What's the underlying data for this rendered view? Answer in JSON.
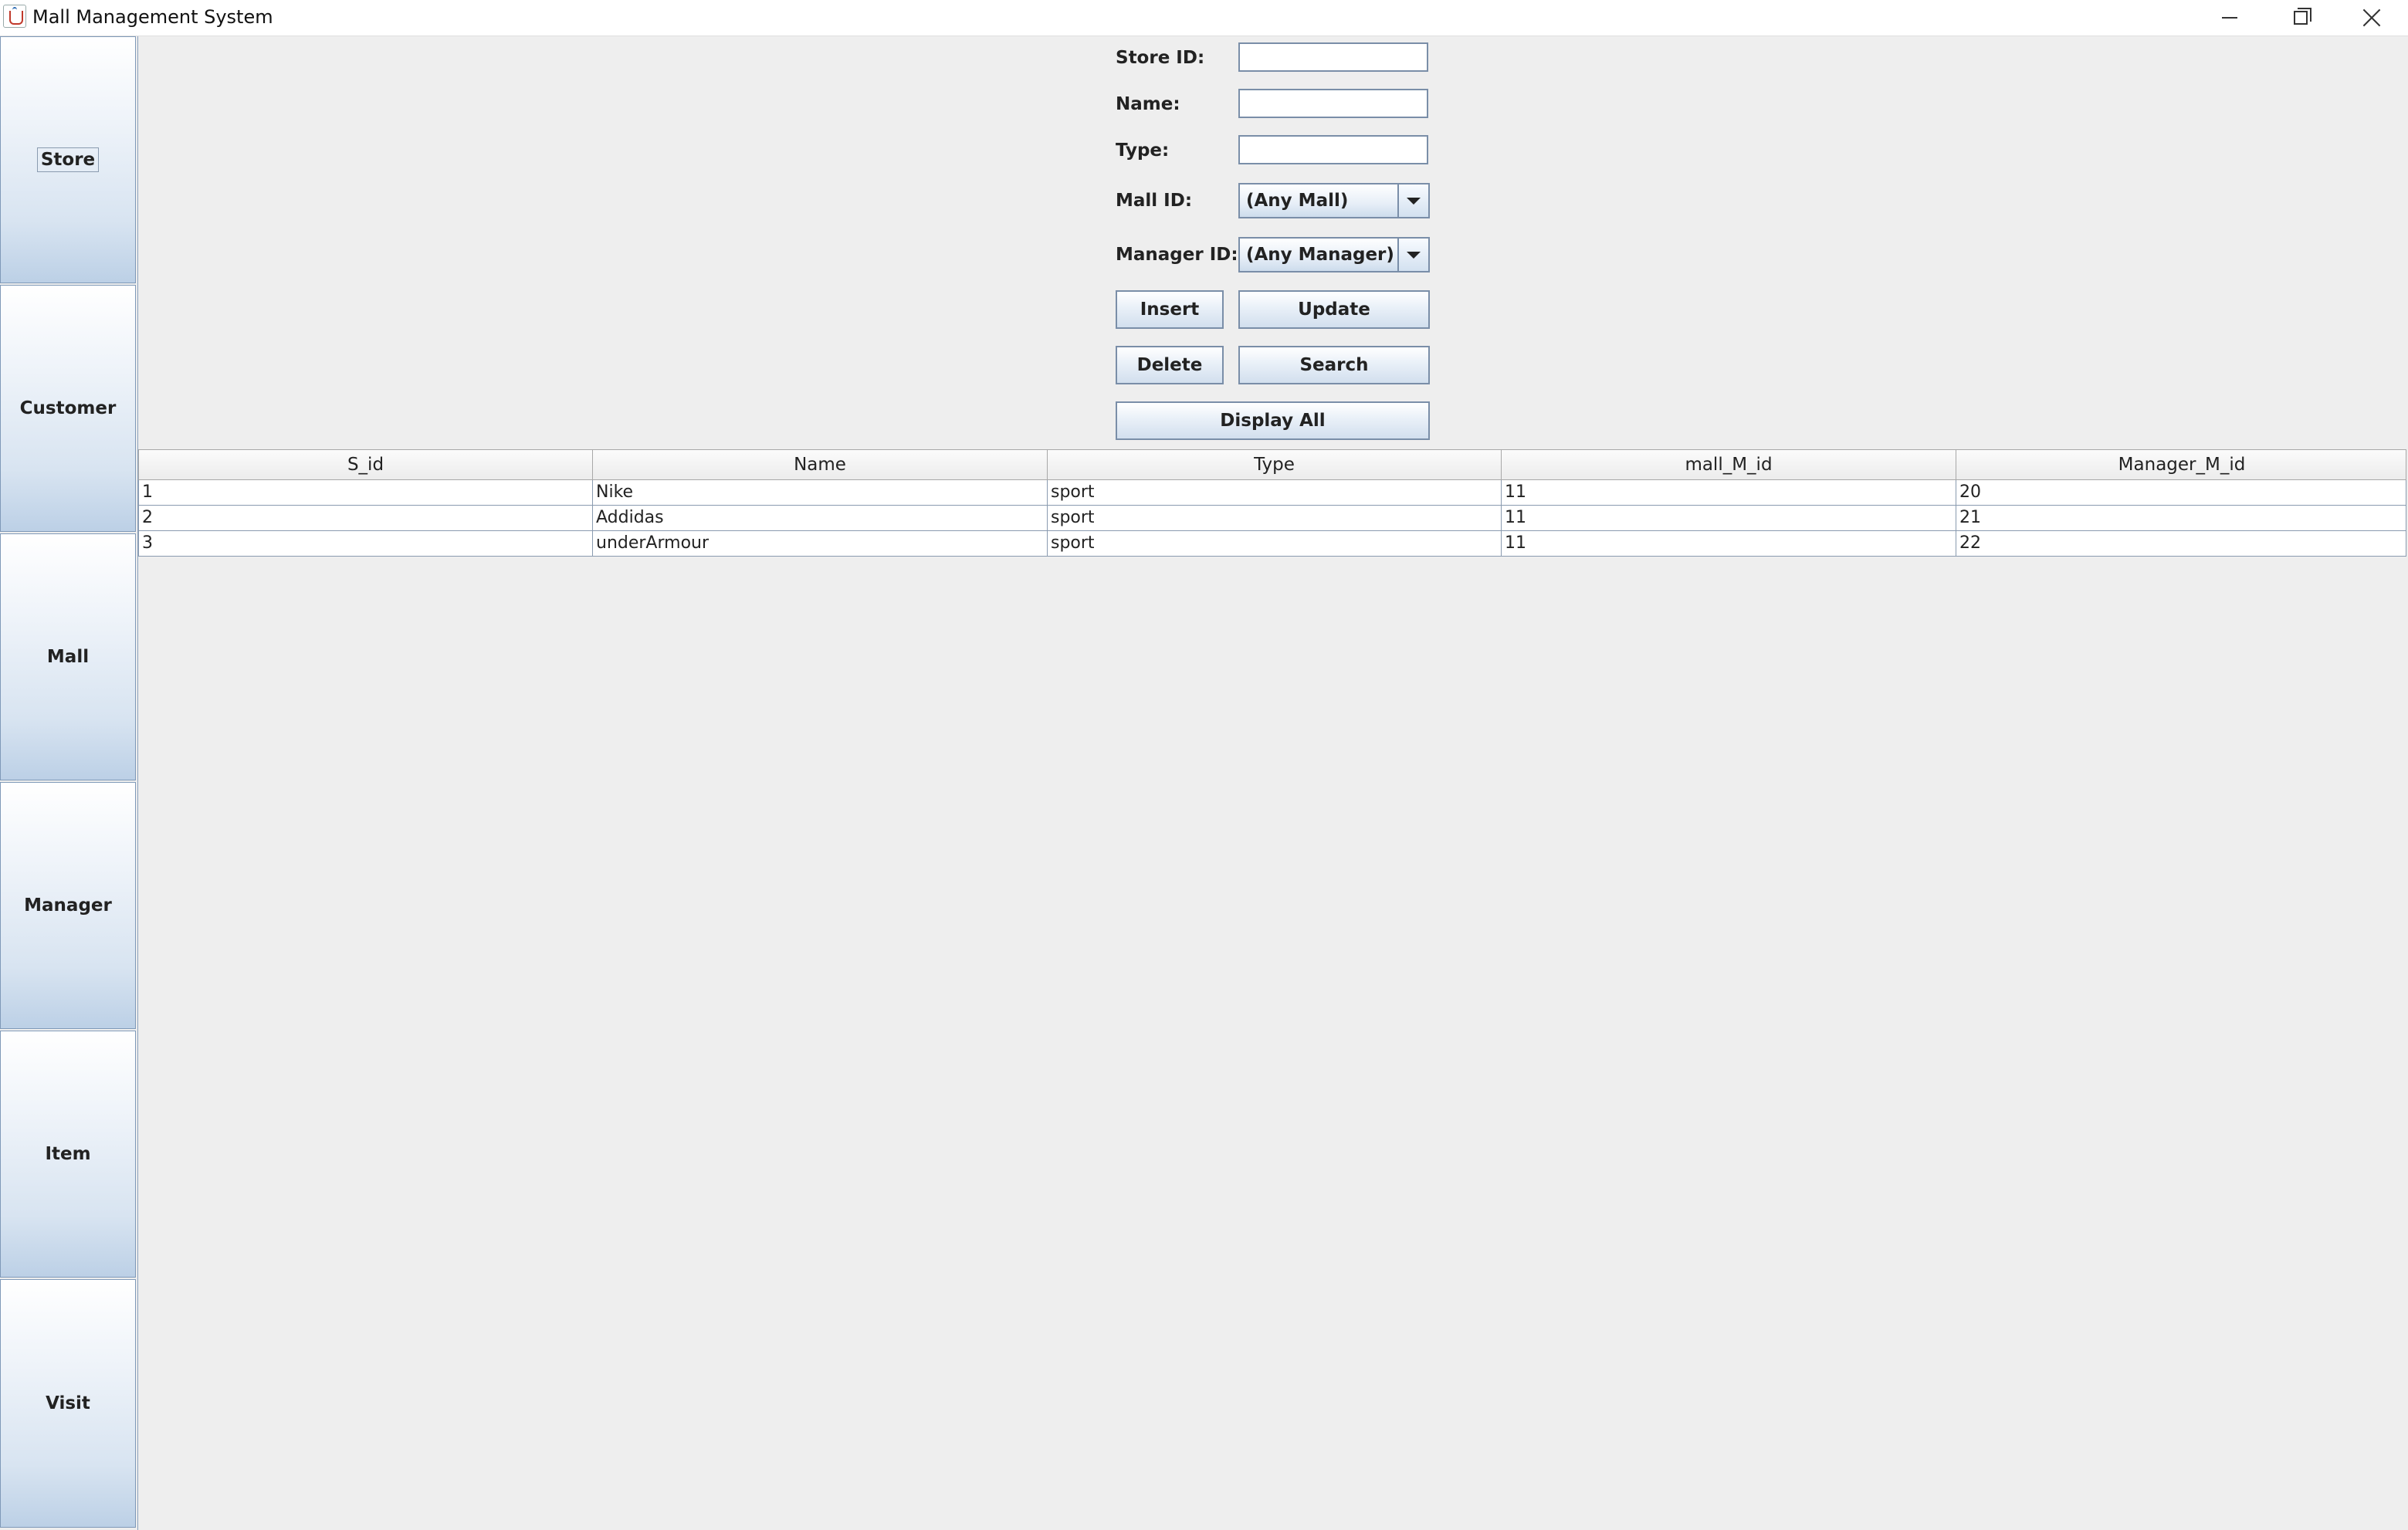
{
  "window": {
    "title": "Mall Management System",
    "controls": {
      "minimize": "minimize",
      "maximize": "restore",
      "close": "close"
    }
  },
  "sidebar": {
    "items": [
      {
        "label": "Store",
        "selected": true
      },
      {
        "label": "Customer",
        "selected": false
      },
      {
        "label": "Mall",
        "selected": false
      },
      {
        "label": "Manager",
        "selected": false
      },
      {
        "label": "Item",
        "selected": false
      },
      {
        "label": "Visit",
        "selected": false
      }
    ]
  },
  "form": {
    "store_id_label": "Store ID:",
    "store_id_value": "",
    "name_label": "Name:",
    "name_value": "",
    "type_label": "Type:",
    "type_value": "",
    "mall_id_label": "Mall ID:",
    "mall_id_selected": "(Any Mall)",
    "manager_id_label": "Manager ID:",
    "manager_id_selected": "(Any Manager)",
    "buttons": {
      "insert": "Insert",
      "update": "Update",
      "delete": "Delete",
      "search": "Search",
      "display_all": "Display All"
    }
  },
  "table": {
    "columns": [
      "S_id",
      "Name",
      "Type",
      "mall_M_id",
      "Manager_M_id"
    ],
    "rows": [
      [
        "1",
        "Nike",
        "sport",
        "11",
        "20"
      ],
      [
        "2",
        "Addidas",
        "sport",
        "11",
        "21"
      ],
      [
        "3",
        "underArmour",
        "sport",
        "11",
        "22"
      ]
    ]
  },
  "colors": {
    "background": "#eeeeee",
    "button_border": "#7a8ea8",
    "sidebar_gradient_bottom": "#bcd0e6"
  }
}
